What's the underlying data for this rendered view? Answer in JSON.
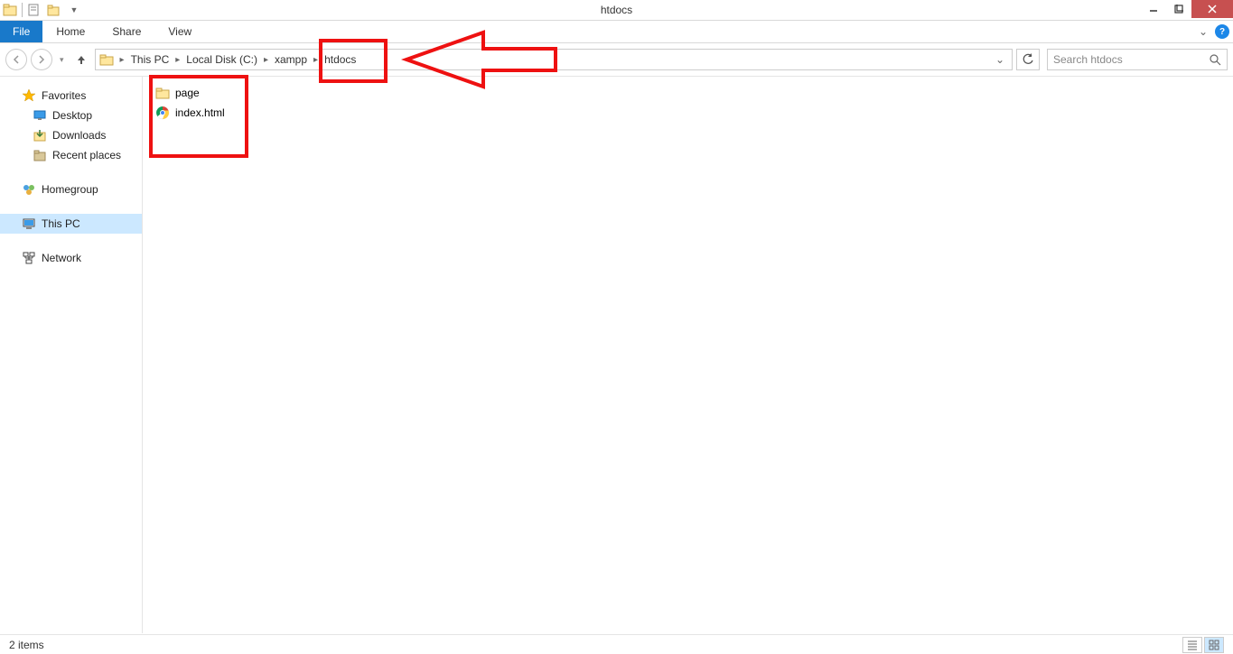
{
  "window": {
    "title": "htdocs"
  },
  "ribbon": {
    "file": "File",
    "tabs": [
      "Home",
      "Share",
      "View"
    ]
  },
  "breadcrumb": {
    "items": [
      "This PC",
      "Local Disk (C:)",
      "xampp",
      "htdocs"
    ]
  },
  "search": {
    "placeholder": "Search htdocs"
  },
  "sidebar": {
    "favorites": {
      "label": "Favorites",
      "items": [
        {
          "label": "Desktop",
          "icon": "desktop"
        },
        {
          "label": "Downloads",
          "icon": "downloads"
        },
        {
          "label": "Recent places",
          "icon": "recent"
        }
      ]
    },
    "homegroup": {
      "label": "Homegroup"
    },
    "thispc": {
      "label": "This PC"
    },
    "network": {
      "label": "Network"
    }
  },
  "files": [
    {
      "name": "page",
      "type": "folder"
    },
    {
      "name": "index.html",
      "type": "html"
    }
  ],
  "status": {
    "text": "2 items"
  }
}
